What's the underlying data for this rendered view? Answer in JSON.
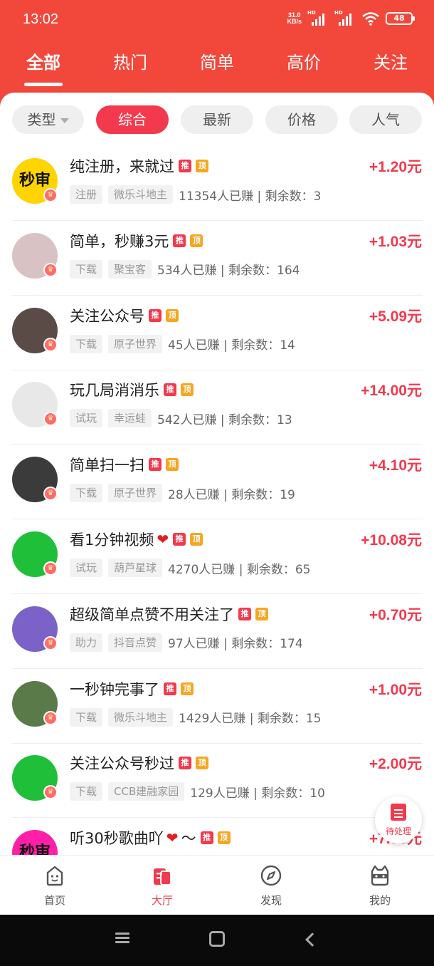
{
  "status_bar": {
    "time": "13:02",
    "net_speed_value": "31.0",
    "net_speed_unit": "KB/s",
    "signal_label_1": "HD",
    "signal_label_2": "HD",
    "battery": "48"
  },
  "top_tabs": [
    {
      "label": "全部",
      "active": true
    },
    {
      "label": "热门",
      "active": false
    },
    {
      "label": "简单",
      "active": false
    },
    {
      "label": "高价",
      "active": false
    },
    {
      "label": "关注",
      "active": false
    }
  ],
  "filters": [
    {
      "label": "类型",
      "active": false,
      "dropdown": true
    },
    {
      "label": "综合",
      "active": true
    },
    {
      "label": "最新",
      "active": false
    },
    {
      "label": "价格",
      "active": false
    },
    {
      "label": "人气",
      "active": false
    }
  ],
  "badges": {
    "recommend": "推",
    "top": "顶"
  },
  "tasks": [
    {
      "title": "纯注册，来就过",
      "heart": false,
      "price": "+1.20元",
      "tag1": "注册",
      "tag2": "微乐斗地主",
      "stats": "11354人已赚 | 剩余数：3",
      "avatar_text": "秒审",
      "avatar_color": "#ffd400"
    },
    {
      "title": "简单，秒赚3元",
      "heart": false,
      "price": "+1.03元",
      "tag1": "下载",
      "tag2": "聚宝客",
      "stats": "534人已赚 | 剩余数：164",
      "avatar_text": "",
      "avatar_color": "#d9c2c4"
    },
    {
      "title": "关注公众号",
      "heart": false,
      "price": "+5.09元",
      "tag1": "下载",
      "tag2": "原子世界",
      "stats": "45人已赚 | 剩余数：14",
      "avatar_text": "",
      "avatar_color": "#5a4b46"
    },
    {
      "title": "玩几局消消乐",
      "heart": false,
      "price": "+14.00元",
      "tag1": "试玩",
      "tag2": "幸运蛙",
      "stats": "542人已赚 | 剩余数：13",
      "avatar_text": "",
      "avatar_color": "#e8e8e8"
    },
    {
      "title": "简单扫一扫",
      "heart": false,
      "price": "+4.10元",
      "tag1": "下载",
      "tag2": "原子世界",
      "stats": "28人已赚 | 剩余数：19",
      "avatar_text": "",
      "avatar_color": "#3b3b3b"
    },
    {
      "title": "看1分钟视频",
      "heart": true,
      "price": "+10.08元",
      "tag1": "试玩",
      "tag2": "葫芦星球",
      "stats": "4270人已赚 | 剩余数：65",
      "avatar_text": "",
      "avatar_color": "#1fbf3a"
    },
    {
      "title": "超级简单点赞不用关注了",
      "heart": false,
      "price": "+0.70元",
      "tag1": "助力",
      "tag2": "抖音点赞",
      "stats": "97人已赚 | 剩余数：174",
      "avatar_text": "",
      "avatar_color": "#7b62c9"
    },
    {
      "title": "一秒钟完事了",
      "heart": false,
      "price": "+1.00元",
      "tag1": "下载",
      "tag2": "微乐斗地主",
      "stats": "1429人已赚 | 剩余数：15",
      "avatar_text": "",
      "avatar_color": "#5b7a4a"
    },
    {
      "title": "关注公众号秒过",
      "heart": false,
      "price": "+2.00元",
      "tag1": "下载",
      "tag2": "CCB建融家园",
      "stats": "129人已赚 | 剩余数：10",
      "avatar_text": "",
      "avatar_color": "#1fbf3a"
    },
    {
      "title": "听30秒歌曲吖",
      "heart": true,
      "tilde": "～",
      "price": "+7.00元",
      "tag1": "",
      "tag2": "",
      "stats": "",
      "avatar_text": "秒审",
      "avatar_color": "#ff1fa8"
    }
  ],
  "float_button": {
    "label": "待处理",
    "icon": "clipboard-icon"
  },
  "bottom_nav": [
    {
      "label": "首页",
      "icon": "home-face-icon",
      "active": false
    },
    {
      "label": "大厅",
      "icon": "hall-icon",
      "active": true
    },
    {
      "label": "发现",
      "icon": "compass-icon",
      "active": false
    },
    {
      "label": "我的",
      "icon": "cat-face-icon",
      "active": false
    }
  ],
  "colors": {
    "brand": "#f2483c",
    "price": "#f2394d",
    "recommend_badge": "#f2394d",
    "top_badge": "#f5a623"
  }
}
